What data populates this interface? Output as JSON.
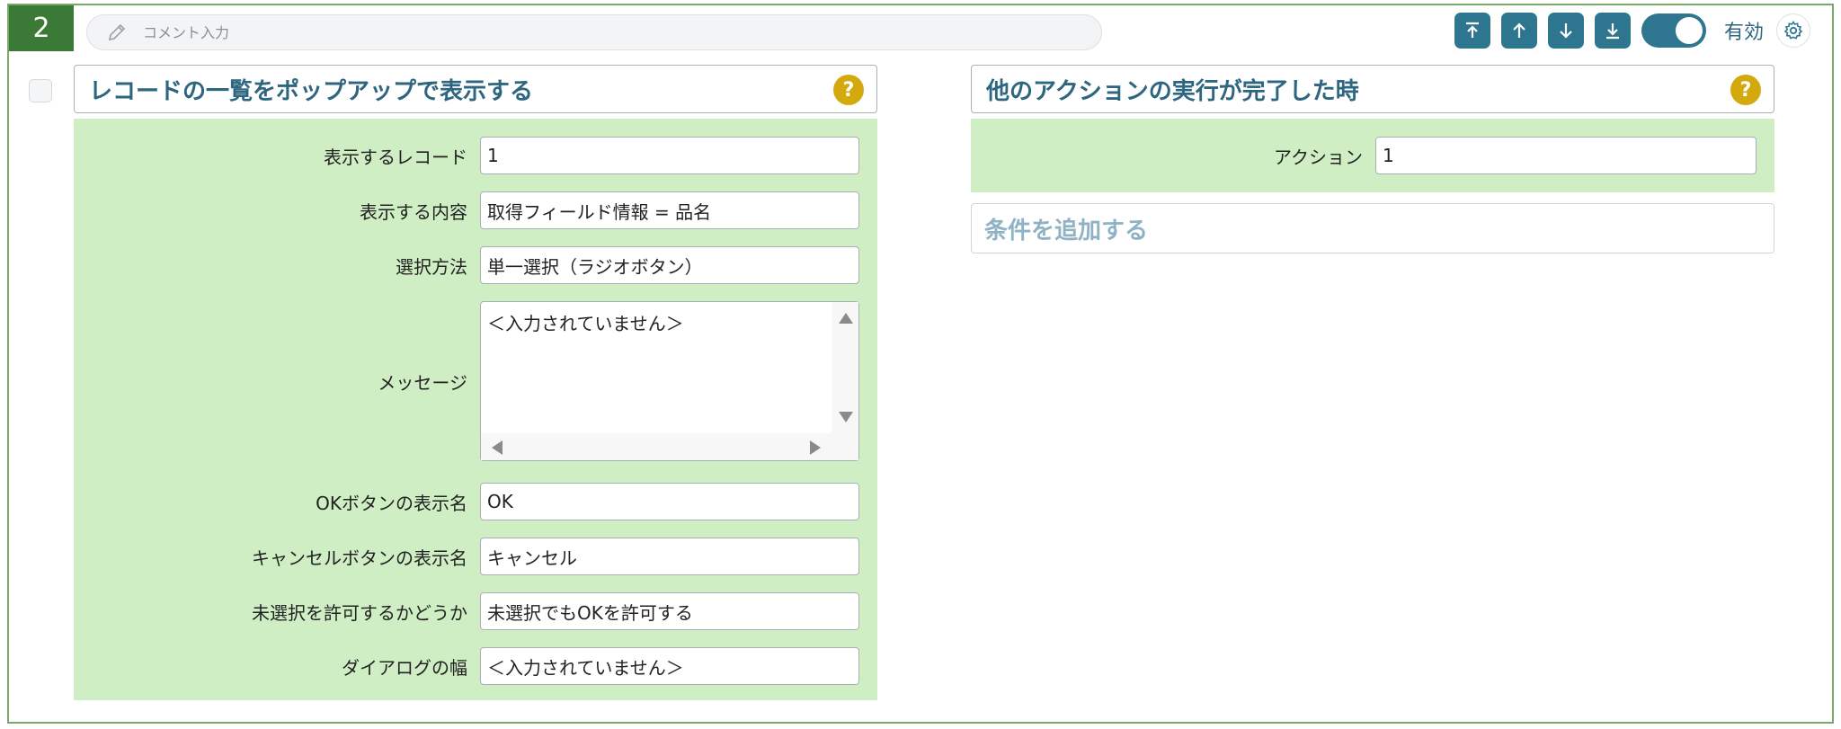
{
  "step": {
    "number": "2"
  },
  "comment": {
    "placeholder": "コメント入力"
  },
  "toolbar": {
    "buttons": [
      "move-to-top",
      "move-up",
      "move-down",
      "move-to-bottom"
    ],
    "toggle_label": "有効",
    "toggle_on": true,
    "accent_color": "#2e7590"
  },
  "left_panel": {
    "title": "レコードの一覧をポップアップで表示する",
    "help": "?",
    "fields": {
      "records": {
        "label": "表示するレコード",
        "value": "1"
      },
      "content": {
        "label": "表示する内容",
        "value": "取得フィールド情報 = 品名"
      },
      "selection": {
        "label": "選択方法",
        "value": "単一選択（ラジオボタン）"
      },
      "message": {
        "label": "メッセージ",
        "value": "＜入力されていません＞"
      },
      "ok_name": {
        "label": "OKボタンの表示名",
        "value": "OK"
      },
      "cancel_name": {
        "label": "キャンセルボタンの表示名",
        "value": "キャンセル"
      },
      "allow_none": {
        "label": "未選択を許可するかどうか",
        "value": "未選択でもOKを許可する"
      },
      "dialog_width": {
        "label": "ダイアログの幅",
        "value": "＜入力されていません＞"
      }
    }
  },
  "right_panel": {
    "title": "他のアクションの実行が完了した時",
    "help": "?",
    "action": {
      "label": "アクション",
      "value": "1"
    },
    "add_condition": "条件を追加する"
  },
  "colors": {
    "step_badge": "#3a7a36",
    "panel_bg": "#cfeec4",
    "title_text": "#2e6680",
    "help_badge": "#d4a90d"
  }
}
